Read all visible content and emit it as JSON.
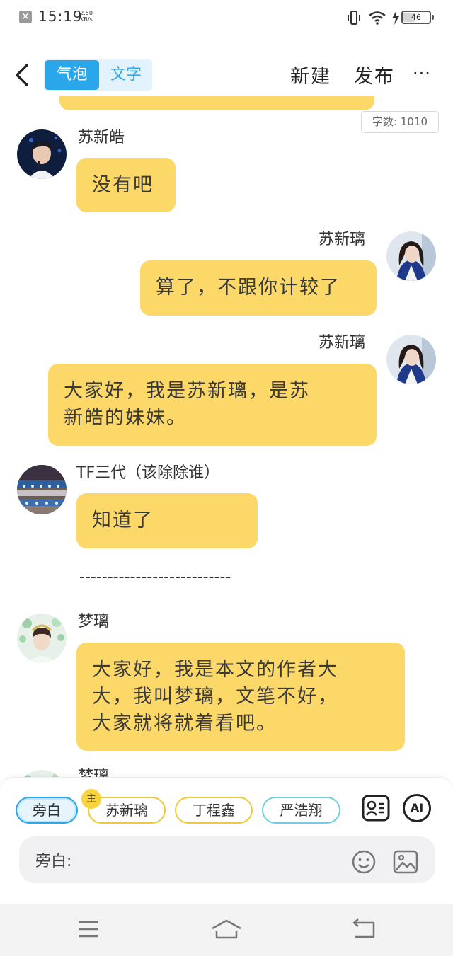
{
  "status_bar": {
    "notification": "×",
    "time": "15:19",
    "net_speed_value": "2.50",
    "net_speed_unit": "KB/s",
    "battery": "46"
  },
  "header": {
    "tab_bubble": "气泡",
    "tab_text": "文字",
    "new_label": "新建",
    "publish_label": "发布",
    "more_label": "···"
  },
  "word_count": "字数: 1010",
  "messages": [
    {
      "name": "苏新皓",
      "text": "没有吧"
    },
    {
      "name": "苏新璃",
      "text": "算了，不跟你计较了"
    },
    {
      "name": "苏新璃",
      "text_lines": [
        "大家好，我是苏新璃，是苏",
        "新皓的妹妹。"
      ]
    },
    {
      "name": "TF三代（该除除谁）",
      "text": "知道了"
    },
    {
      "divider": "---------------------------"
    },
    {
      "name": "梦璃",
      "text_lines": [
        "大家好，我是本文的作者大",
        "大，我叫梦璃，文笔不好，",
        "大家就将就着看吧。"
      ]
    },
    {
      "name": "梦璃"
    }
  ],
  "composer": {
    "chips": [
      "旁白",
      "苏新璃",
      "丁程鑫",
      "严浩翔"
    ],
    "main_badge": "主",
    "ai_label": "AI",
    "input_label": "旁白:"
  },
  "colors": {
    "bubble": "#fcd869",
    "accent_blue": "#2aa6ea",
    "chip_yellow": "#f0c93a",
    "chip_teal": "#6ecfe0"
  }
}
